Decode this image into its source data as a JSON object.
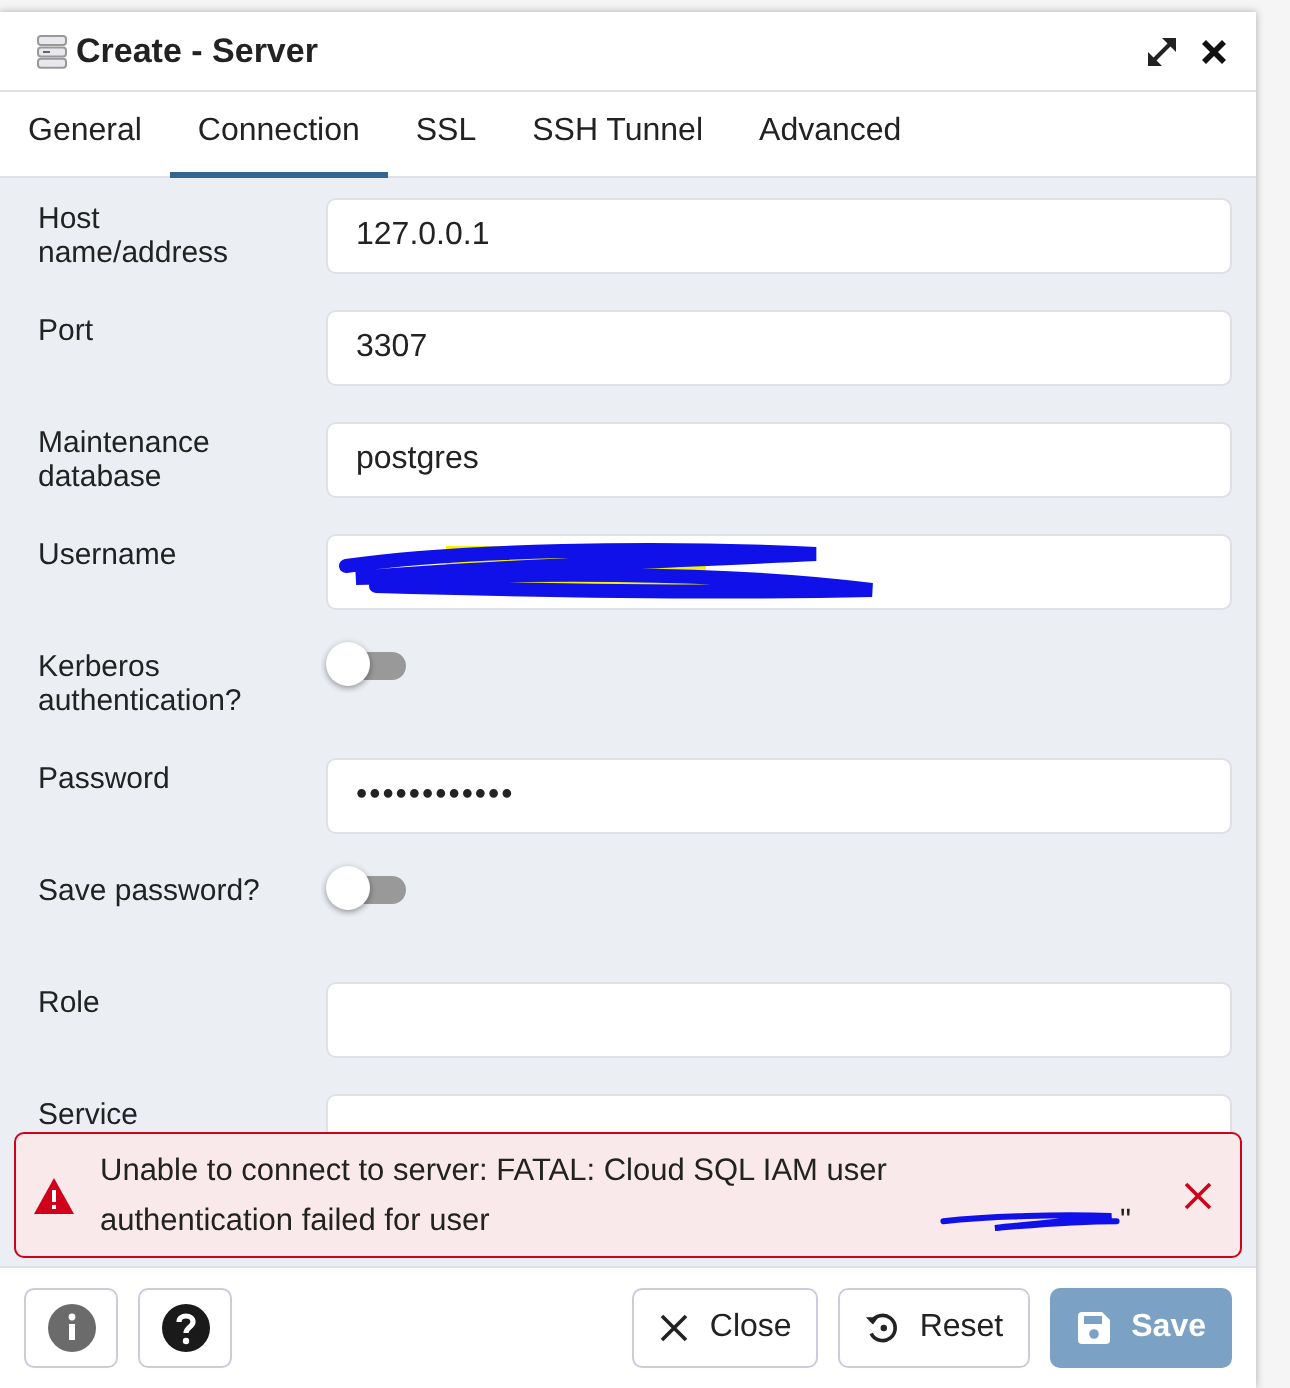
{
  "window": {
    "title": "Create - Server"
  },
  "tabs": [
    {
      "label": "General",
      "selected": false
    },
    {
      "label": "Connection",
      "selected": true
    },
    {
      "label": "SSL",
      "selected": false
    },
    {
      "label": "SSH Tunnel",
      "selected": false
    },
    {
      "label": "Advanced",
      "selected": false
    }
  ],
  "fields": [
    {
      "kind": "text",
      "label": "Host name/address",
      "value": "127.0.0.1"
    },
    {
      "kind": "text",
      "label": "Port",
      "value": "3307"
    },
    {
      "kind": "text",
      "label": "Maintenance database",
      "value": "postgres"
    },
    {
      "kind": "redacted",
      "label": "Username"
    },
    {
      "kind": "switch",
      "label": "Kerberos authentication?",
      "on": false
    },
    {
      "kind": "password",
      "label": "Password",
      "value": "••••••••••••"
    },
    {
      "kind": "switch",
      "label": "Save password?",
      "on": false
    },
    {
      "kind": "text",
      "label": "Role"
    },
    {
      "kind": "text",
      "label": "Service"
    }
  ],
  "alert": {
    "message": "Unable to connect to server: FATAL: Cloud SQL IAM user authentication failed for user",
    "tail": "\""
  },
  "footer": {
    "buttons": [
      {
        "label": "Close",
        "kind": "close"
      },
      {
        "label": "Reset",
        "kind": "reset"
      },
      {
        "label": "Save",
        "kind": "save",
        "disabled": true
      }
    ]
  }
}
